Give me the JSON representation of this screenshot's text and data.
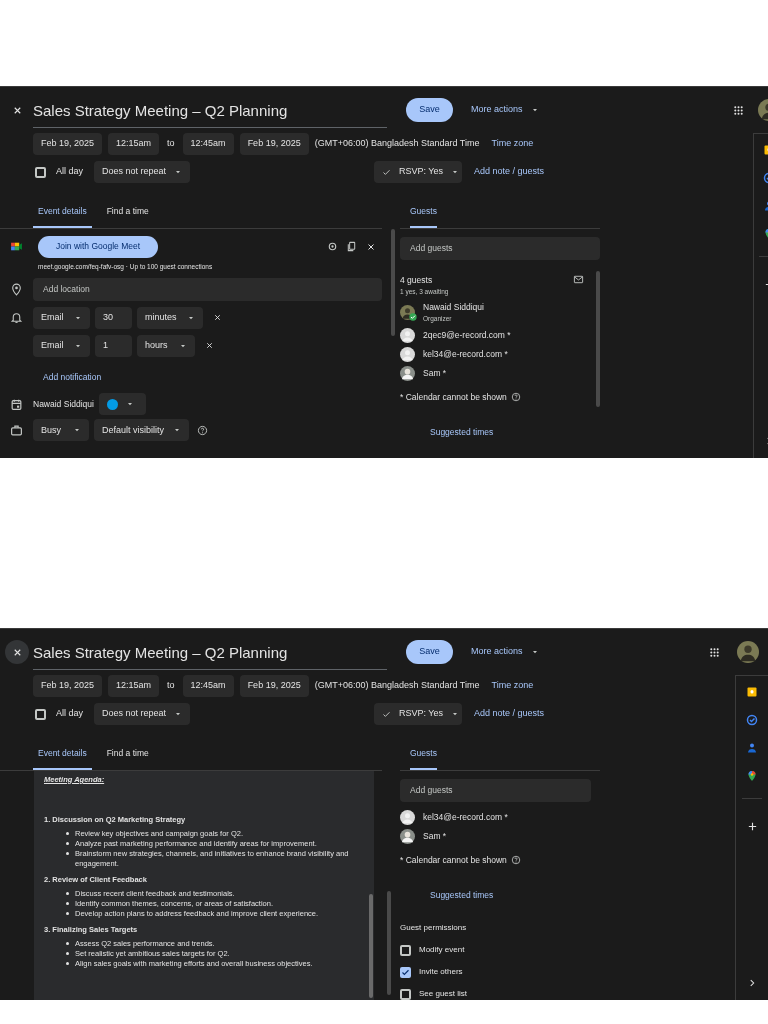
{
  "screenshots": [
    {
      "header": {
        "close_hovered": false,
        "title": "Sales Strategy Meeting – Q2 Planning",
        "save": "Save",
        "more_actions": "More actions",
        "start_date": "Feb 19, 2025",
        "start_time": "12:15am",
        "to": "to",
        "end_time": "12:45am",
        "end_date": "Feb 19, 2025",
        "timezone": "(GMT+06:00) Bangladesh Standard Time",
        "timezone_link": "Time zone",
        "all_day": {
          "label": "All day",
          "checked": false
        },
        "repeat": "Does not repeat",
        "rsvp": "RSVP: Yes",
        "add_note": "Add note / guests"
      },
      "tabs": [
        {
          "label": "Event details",
          "selected": true
        },
        {
          "label": "Find a time",
          "selected": false
        }
      ],
      "guests_tab": {
        "label": "Guests",
        "selected": true
      },
      "details": {
        "meet_button": "Join with Google Meet",
        "meet_link": "meet.google.com/feq-fafv-osg · Up to 100 guest connections",
        "location_placeholder": "Add location",
        "notifications": [
          {
            "method": "Email",
            "value": "30",
            "unit": "minutes"
          },
          {
            "method": "Email",
            "value": "1",
            "unit": "hours"
          }
        ],
        "add_notification": "Add notification",
        "calendar": {
          "owner": "Nawaid Siddiqui",
          "color": "#039be5"
        },
        "status": "Busy",
        "visibility": "Default visibility"
      },
      "guests": {
        "add_placeholder": "Add guests",
        "count": "4 guests",
        "summary": "1 yes, 3 awaiting",
        "list": [
          {
            "name": "Nawaid Siddiqui",
            "role": "Organizer",
            "kind": "photo",
            "accepted": true
          },
          {
            "name": "2qec9@e-record.com *",
            "kind": "blank",
            "accepted": false
          },
          {
            "name": "kel34@e-record.com *",
            "kind": "blank",
            "accepted": false
          },
          {
            "name": "Sam *",
            "kind": "photo",
            "accepted": false
          }
        ],
        "calendar_note": "* Calendar cannot be shown",
        "suggested": "Suggested times"
      }
    },
    {
      "header": {
        "close_hovered": true,
        "title": "Sales Strategy Meeting – Q2 Planning",
        "save": "Save",
        "more_actions": "More actions",
        "start_date": "Feb 19, 2025",
        "start_time": "12:15am",
        "to": "to",
        "end_time": "12:45am",
        "end_date": "Feb 19, 2025",
        "timezone": "(GMT+06:00) Bangladesh Standard Time",
        "timezone_link": "Time zone",
        "all_day": {
          "label": "All day",
          "checked": false
        },
        "repeat": "Does not repeat",
        "rsvp": "RSVP: Yes",
        "add_note": "Add note / guests"
      },
      "tabs": [
        {
          "label": "Event details",
          "selected": true
        },
        {
          "label": "Find a time",
          "selected": false
        }
      ],
      "guests_tab": {
        "label": "Guests",
        "selected": true
      },
      "description": {
        "heading": "Meeting Agenda:",
        "sections": [
          {
            "title": "1. Discussion on Q2 Marketing Strategy",
            "bullets": [
              "Review key objectives and campaign goals for Q2.",
              "Analyze past marketing performance and identify areas for improvement.",
              "Brainstorm new strategies, channels, and initiatives to enhance brand visibility and engagement."
            ]
          },
          {
            "title": "2. Review of Client Feedback",
            "bullets": [
              "Discuss recent client feedback and testimonials.",
              "Identify common themes, concerns, or areas of satisfaction.",
              "Develop action plans to address feedback and improve client experience."
            ]
          },
          {
            "title": "3. Finalizing Sales Targets",
            "bullets": [
              "Assess Q2 sales performance and trends.",
              "Set realistic yet ambitious sales targets for Q2.",
              "Align sales goals with marketing efforts and overall business objectives."
            ]
          }
        ]
      },
      "guests": {
        "add_placeholder": "Add guests",
        "list": [
          {
            "name": "kel34@e-record.com *",
            "kind": "blank",
            "accepted": false
          },
          {
            "name": "Sam *",
            "kind": "photo",
            "accepted": false
          }
        ],
        "calendar_note": "* Calendar cannot be shown",
        "suggested": "Suggested times",
        "permissions_title": "Guest permissions",
        "permissions": [
          {
            "label": "Modify event",
            "checked": false
          },
          {
            "label": "Invite others",
            "checked": true
          },
          {
            "label": "See guest list",
            "checked": false
          }
        ]
      }
    }
  ]
}
